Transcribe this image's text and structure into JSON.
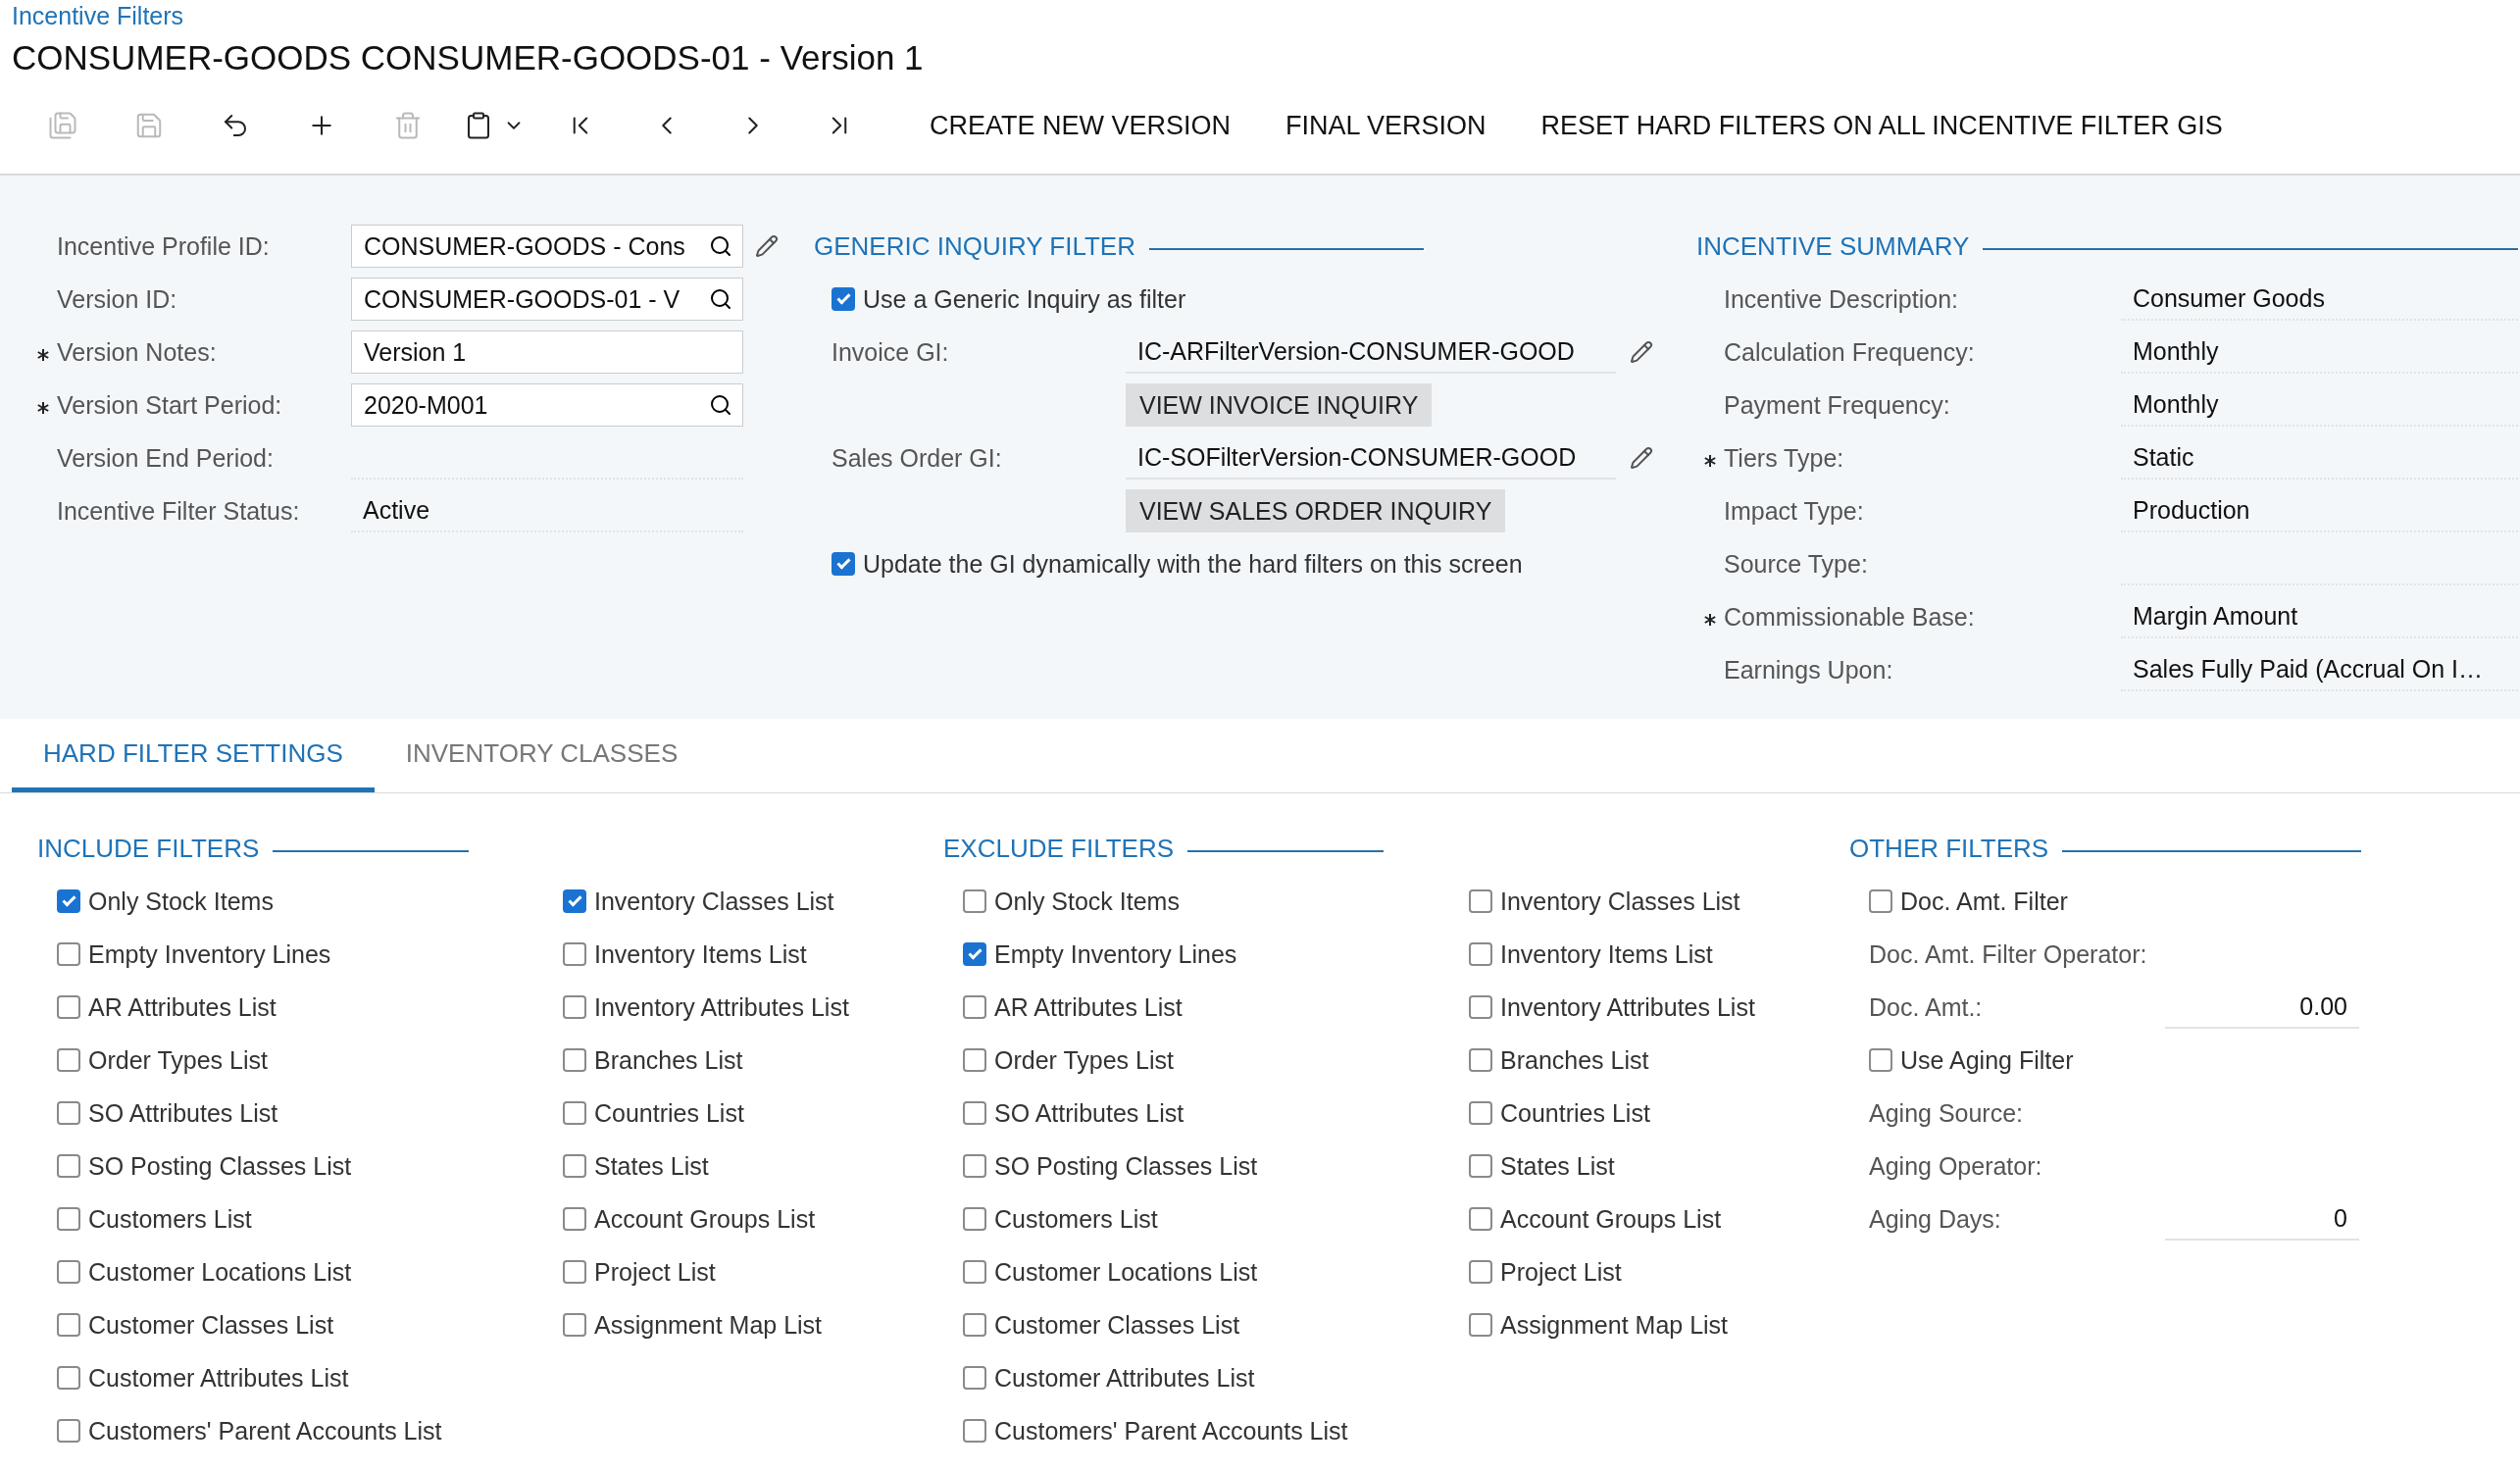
{
  "breadcrumb": "Incentive Filters",
  "title": "CONSUMER-GOODS CONSUMER-GOODS-01 - Version 1",
  "toolbar": {
    "icons": [
      {
        "kind": "save-close",
        "disabled": true
      },
      {
        "kind": "save",
        "disabled": true
      },
      {
        "kind": "undo",
        "disabled": false
      },
      {
        "kind": "add",
        "disabled": false
      },
      {
        "kind": "delete",
        "disabled": true
      },
      {
        "kind": "paste",
        "disabled": false
      },
      {
        "kind": "first",
        "disabled": false
      },
      {
        "kind": "previous",
        "disabled": false
      },
      {
        "kind": "next",
        "disabled": false
      },
      {
        "kind": "last",
        "disabled": false
      }
    ],
    "actions": [
      "CREATE NEW VERSION",
      "FINAL VERSION",
      "RESET HARD FILTERS ON ALL INCENTIVE FILTER GIS"
    ]
  },
  "general": {
    "fields": [
      {
        "label": "Incentive Profile ID:",
        "required": false,
        "kind": "lookup",
        "value": "CONSUMER-GOODS - Cons",
        "edit_icon": true
      },
      {
        "label": "Version ID:",
        "required": false,
        "kind": "lookup",
        "value": "CONSUMER-GOODS-01 - V",
        "edit_icon": false
      },
      {
        "label": "Version Notes:",
        "required": true,
        "kind": "text",
        "value": "Version 1",
        "edit_icon": false
      },
      {
        "label": "Version Start Period:",
        "required": true,
        "kind": "lookup",
        "value": "2020-M001",
        "edit_icon": false
      },
      {
        "label": "Version End Period:",
        "required": false,
        "kind": "readonly",
        "edit_icon": false
      },
      {
        "label": "Incentive Filter Status:",
        "required": false,
        "kind": "readonly",
        "value": "Active",
        "edit_icon": false
      }
    ]
  },
  "generic_inquiry": {
    "title": "GENERIC INQUIRY FILTER",
    "use_gi": {
      "label": "Use a Generic Inquiry as filter",
      "checked": true
    },
    "inquiries": [
      {
        "label": "Invoice GI:",
        "value": "IC-ARFilterVersion-CONSUMER-GOOD",
        "button": "VIEW INVOICE INQUIRY"
      },
      {
        "label": "Sales Order GI:",
        "value": "IC-SOFilterVersion-CONSUMER-GOOD",
        "button": "VIEW SALES ORDER INQUIRY"
      }
    ],
    "update_gi": {
      "label": "Update the GI dynamically with the hard filters on this screen",
      "checked": true
    }
  },
  "summary": {
    "title": "INCENTIVE SUMMARY",
    "rows": [
      {
        "label": "Incentive Description:",
        "value": "Consumer Goods",
        "required": false
      },
      {
        "label": "Calculation Frequency:",
        "value": "Monthly",
        "required": false
      },
      {
        "label": "Payment Frequency:",
        "value": "Monthly",
        "required": false
      },
      {
        "label": "Tiers Type:",
        "value": "Static",
        "required": true
      },
      {
        "label": "Impact Type:",
        "value": "Production",
        "required": false
      },
      {
        "label": "Source Type:",
        "required": false
      },
      {
        "label": "Commissionable Base:",
        "value": "Margin Amount",
        "required": true
      },
      {
        "label": "Earnings Upon:",
        "value": "Sales Fully Paid (Accrual On I…",
        "required": false
      }
    ]
  },
  "tabs": [
    {
      "label": "HARD FILTER SETTINGS",
      "selected": true
    },
    {
      "label": "INVENTORY CLASSES",
      "selected": false
    }
  ],
  "include_filters": {
    "title": "INCLUDE FILTERS",
    "columns": [
      [
        {
          "label": "Only Stock Items",
          "checked": true
        },
        {
          "label": "Empty Inventory Lines",
          "checked": false
        },
        {
          "label": "AR Attributes List",
          "checked": false
        },
        {
          "label": "Order Types List",
          "checked": false
        },
        {
          "label": "SO Attributes List",
          "checked": false
        },
        {
          "label": "SO Posting Classes List",
          "checked": false
        },
        {
          "label": "Customers List",
          "checked": false
        },
        {
          "label": "Customer Locations List",
          "checked": false
        },
        {
          "label": "Customer Classes List",
          "checked": false
        },
        {
          "label": "Customer Attributes List",
          "checked": false
        },
        {
          "label": "Customers' Parent Accounts List",
          "checked": false
        }
      ],
      [
        {
          "label": "Inventory Classes List",
          "checked": true
        },
        {
          "label": "Inventory Items List",
          "checked": false
        },
        {
          "label": "Inventory Attributes List",
          "checked": false
        },
        {
          "label": "Branches List",
          "checked": false
        },
        {
          "label": "Countries List",
          "checked": false
        },
        {
          "label": "States List",
          "checked": false
        },
        {
          "label": "Account Groups List",
          "checked": false
        },
        {
          "label": "Project List",
          "checked": false
        },
        {
          "label": "Assignment Map List",
          "checked": false
        }
      ]
    ]
  },
  "exclude_filters": {
    "title": "EXCLUDE FILTERS",
    "columns": [
      [
        {
          "label": "Only Stock Items",
          "checked": false
        },
        {
          "label": "Empty Inventory Lines",
          "checked": true
        },
        {
          "label": "AR Attributes List",
          "checked": false
        },
        {
          "label": "Order Types List",
          "checked": false
        },
        {
          "label": "SO Attributes List",
          "checked": false
        },
        {
          "label": "SO Posting Classes List",
          "checked": false
        },
        {
          "label": "Customers List",
          "checked": false
        },
        {
          "label": "Customer Locations List",
          "checked": false
        },
        {
          "label": "Customer Classes List",
          "checked": false
        },
        {
          "label": "Customer Attributes List",
          "checked": false
        },
        {
          "label": "Customers' Parent Accounts List",
          "checked": false
        }
      ],
      [
        {
          "label": "Inventory Classes List",
          "checked": false
        },
        {
          "label": "Inventory Items List",
          "checked": false
        },
        {
          "label": "Inventory Attributes List",
          "checked": false
        },
        {
          "label": "Branches List",
          "checked": false
        },
        {
          "label": "Countries List",
          "checked": false
        },
        {
          "label": "States List",
          "checked": false
        },
        {
          "label": "Account Groups List",
          "checked": false
        },
        {
          "label": "Project List",
          "checked": false
        },
        {
          "label": "Assignment Map List",
          "checked": false
        }
      ]
    ]
  },
  "other_filters": {
    "title": "OTHER FILTERS",
    "items": [
      {
        "kind": "checkbox",
        "label": "Doc. Amt. Filter",
        "checked": false
      },
      {
        "kind": "label",
        "label": "Doc. Amt. Filter Operator:"
      },
      {
        "kind": "number",
        "label": "Doc. Amt.:",
        "value": "0.00"
      },
      {
        "kind": "checkbox",
        "label": "Use Aging Filter",
        "checked": false
      },
      {
        "kind": "label",
        "label": "Aging Source:"
      },
      {
        "kind": "label",
        "label": "Aging Operator:"
      },
      {
        "kind": "number",
        "label": "Aging Days:",
        "value": "0"
      }
    ]
  }
}
